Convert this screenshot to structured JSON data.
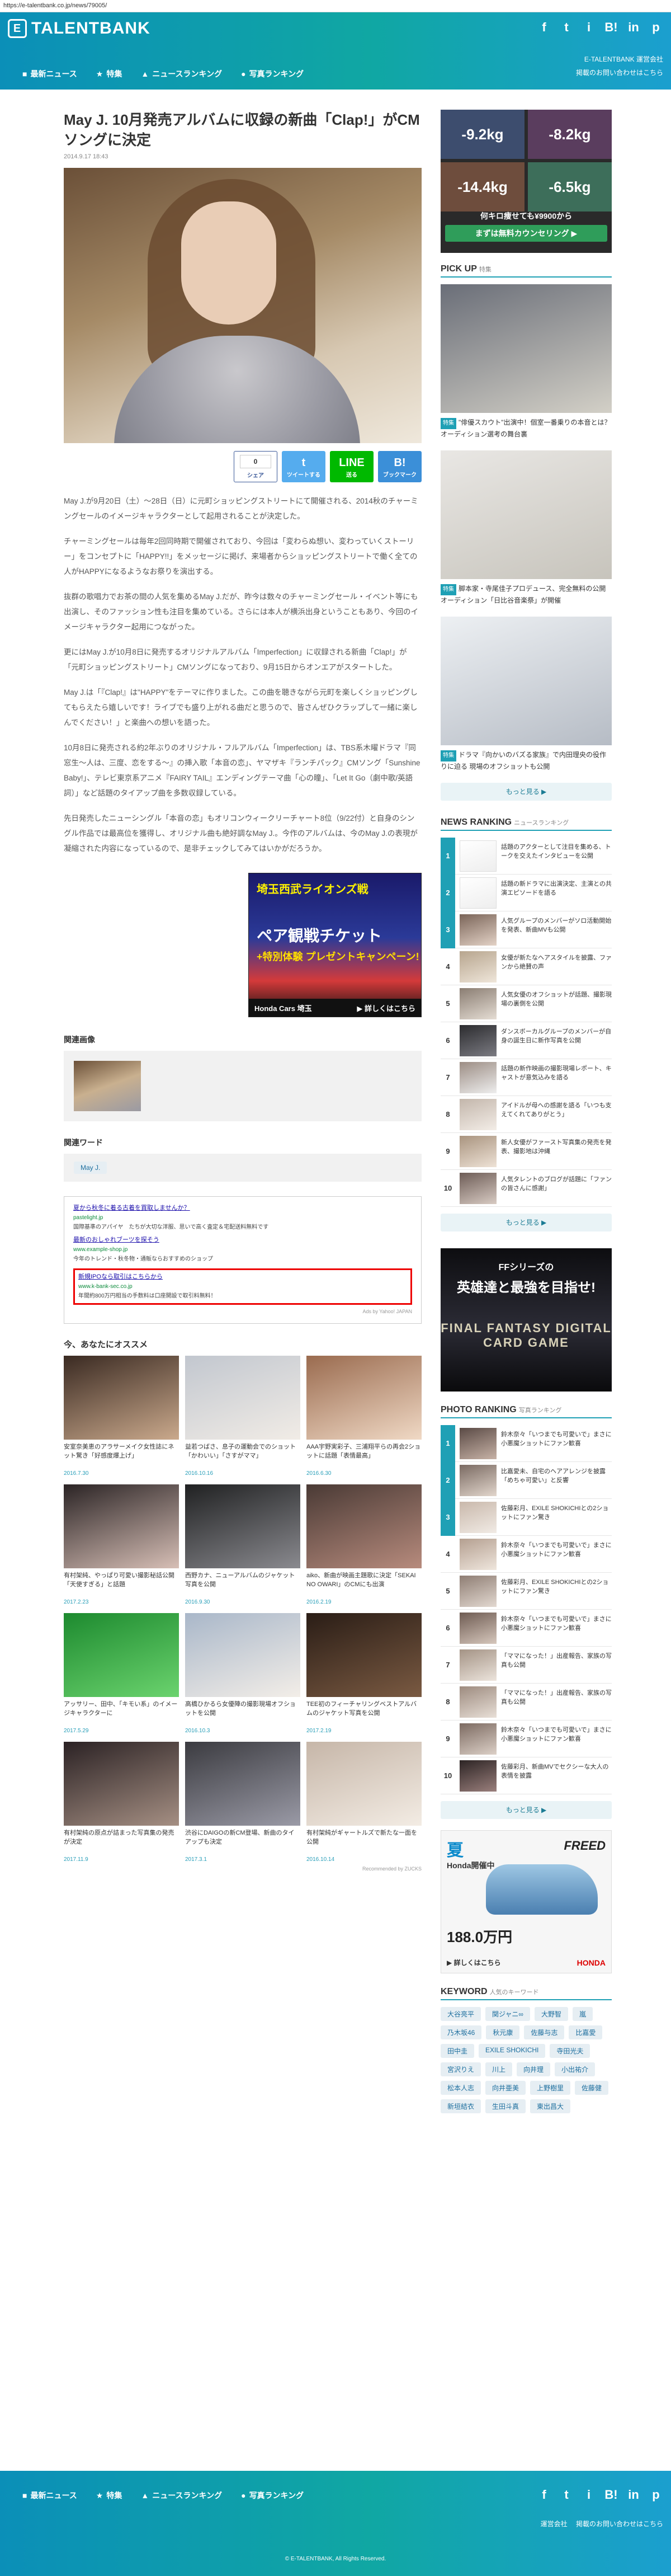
{
  "url": "https://e-talentbank.co.jp/news/79005/",
  "site": {
    "logo_text": "TALENTBANK",
    "social_icons": [
      "f",
      "t",
      "i",
      "B!",
      "in",
      "p"
    ],
    "header_links": [
      "E-TALENTBANK 運営会社",
      "掲載のお問い合わせはこちら"
    ],
    "nav": [
      {
        "icon": "news-icon",
        "glyph": "■",
        "label": "最新ニュース"
      },
      {
        "icon": "feature-icon",
        "glyph": "★",
        "label": "特集"
      },
      {
        "icon": "ranking-icon",
        "glyph": "▲",
        "label": "ニュースランキング"
      },
      {
        "icon": "photo-icon",
        "glyph": "●",
        "label": "写真ランキング"
      }
    ]
  },
  "article": {
    "title": "May J. 10月発売アルバムに収録の新曲「Clap!」がCMソングに決定",
    "date": "2014.9.17 18:43",
    "share": {
      "fb_count": "0",
      "fb_label": "シェア",
      "tw_glyph": "t",
      "tw_label": "ツイートする",
      "line_label": "送る",
      "hb_label": "ブックマーク"
    },
    "paragraphs": [
      "May J.が9月20日（土）〜28日（日）に元町ショッピングストリートにて開催される、2014秋のチャーミングセールのイメージキャラクターとして起用されることが決定した。",
      "チャーミングセールは毎年2回同時期で開催されており、今回は「変わらぬ想い、変わっていくストーリー」をコンセプトに「HAPPY!!」をメッセージに掲げ、来場者からショッピングストリートで働く全ての人がHAPPYになるようなお祭りを演出する。",
      "抜群の歌唱力でお茶の間の人気を集めるMay J.だが、昨今は数々のチャーミングセール・イベント等にも出演し、そのファッション性も注目を集めている。さらには本人が横浜出身ということもあり、今回のイメージキャラクター起用につながった。",
      "更にはMay J.が10月8日に発売するオリジナルアルバム「Imperfection」に収録される新曲「Clap!」が「元町ショッピングストリート」CMソングになっており、9月15日からオンエアがスタートした。",
      "May J.は「『Clap!』は\"HAPPY\"をテーマに作りました。この曲を聴きながら元町を楽しくショッピングしてもらえたら嬉しいです！ライブでも盛り上がれる曲だと思うので、皆さんぜひクラップして一緒に楽しんでください！」と楽曲への想いを語った。",
      "10月8日に発売される約2年ぶりのオリジナル・フルアルバム「Imperfection」は、TBS系木曜ドラマ『同窓生〜人は、三度、恋をする〜』の挿入歌「本音の恋」、ヤマザキ『ランチパック』CMソング「Sunshine Baby!」、テレビ東京系アニメ『FAIRY TAIL』エンディングテーマ曲「心の瞳」、「Let It Go（劇中歌/英語詞）」など話題のタイアップ曲を多数収録している。",
      "先日発売したニューシングル「本音の恋」もオリコンウィークリーチャート8位（9/22付）と自身のシングル作品では最高位を獲得し、オリジナル曲も絶好調なMay J.。今作のアルバムは、今のMay J.の表現が凝縮された内容になっているので、是非チェックしてみてはいかがだろうか。"
    ],
    "related_images_title": "関連画像",
    "related_words_title": "関連ワード",
    "related_words": [
      "May J."
    ]
  },
  "ad_honda": {
    "line1": "埼玉西武ライオンズ戦",
    "line2": "ペア観戦チケット",
    "line3": "+特別体験 プレゼントキャンペーン!",
    "brand": "Honda Cars 埼玉",
    "cta": "▶ 詳しくはこちら"
  },
  "yahoo_ads": {
    "items": [
      {
        "title": "夏から秋冬に着る古着を買取しませんか？",
        "url": "pastelight.jp",
        "desc": "国際基準のアパイヤ　たちが大切な洋服、思いで高く査定＆宅配送料無料です"
      },
      {
        "title": "最新のおしゃれブーツを探そう",
        "url": "www.example-shop.jp",
        "desc": "今年のトレンド・秋冬物・通販ならおすすめのショップ"
      }
    ],
    "highlight": {
      "title": "新規IPOなら取引はこちらから",
      "url": "www.k-bank-sec.co.jp",
      "desc": "年間約800万円相当の手数料は口座開設で取引料無料！"
    },
    "by": "Ads by Yahoo! JAPAN"
  },
  "recommend": {
    "title": "今、あなたにオススメ",
    "by": "Recommended by ZUCKS",
    "items": [
      {
        "caption": "安室奈美恵のアラサーメイク女性誌にネット驚き「好感度爆上げ」",
        "date": "2016.7.30",
        "c1": "#3a2a22",
        "c2": "#caa98c"
      },
      {
        "caption": "益若つばさ、息子の運動会でのショット「かわいい」「さすがママ」",
        "date": "2016.10.16",
        "c1": "#c2c7cf",
        "c2": "#f1ece6"
      },
      {
        "caption": "AAA宇野実彩子、三浦翔平らの再会2ショットに話題「表情最高」",
        "date": "2016.6.30",
        "c1": "#9a6b4f",
        "c2": "#f0d9c5"
      },
      {
        "caption": "有村架純、やっぱり可愛い撮影秘話公開「天使すぎる」と話題",
        "date": "2017.2.23",
        "c1": "#2b2425",
        "c2": "#d7bfb6"
      },
      {
        "caption": "西野カナ、ニューアルバムのジャケット写真を公開",
        "date": "2016.9.30",
        "c1": "#202122",
        "c2": "#8a8a8f"
      },
      {
        "caption": "aiko、新曲が映画主題歌に決定「SEKAI NO OWARI」のCMにも出演",
        "date": "2016.2.19",
        "c1": "#4a3a35",
        "c2": "#b78b7d"
      },
      {
        "caption": "アッサリー、田中、「キモい系」のイメージキャラクターに",
        "date": "2017.5.29",
        "c1": "#1d8a2f",
        "c2": "#6bd36e"
      },
      {
        "caption": "高橋ひかるら女優陣の撮影現場オフショットを公開",
        "date": "2016.10.3",
        "c1": "#a9b7c9",
        "c2": "#f3eee8"
      },
      {
        "caption": "TEE初のフィーチャリングベストアルバムのジャケット写真を公開",
        "date": "2017.2.19",
        "c1": "#2a1d16",
        "c2": "#7a5a42"
      },
      {
        "caption": "有村架純の原点が詰まった写真集の発売が決定",
        "date": "2017.11.9",
        "c1": "#2b2224",
        "c2": "#a58f83"
      },
      {
        "caption": "渋谷にDAIGOの新CM登場、新曲のタイアップも決定",
        "date": "2017.3.1",
        "c1": "#3b3b40",
        "c2": "#9a9aa6"
      },
      {
        "caption": "有村架純がギャートルズで新たな一面を公開",
        "date": "2016.10.14",
        "c1": "#c6b6a8",
        "c2": "#f3ece4"
      }
    ]
  },
  "ad_side": {
    "q1": "-9.2kg",
    "q2": "-8.2kg",
    "q3": "-14.4kg",
    "q4": "-6.5kg",
    "price": "何キロ痩せても¥9900から",
    "cta": "まずは無料カウンセリング ▶"
  },
  "pickup": {
    "title": "PICK UP",
    "sub": "特集",
    "items": [
      {
        "tag": "特集",
        "caption": "\"俳優スカウト\"出演中！個室一番乗りの本音とは？オーディション選考の舞台裏",
        "c1": "#6a6e78",
        "c2": "#d3d0c7"
      },
      {
        "tag": "特集",
        "caption": "脚本家・寺尾佳子プロデュース、完全無料の公開オーディション「日比谷音楽祭」が開催",
        "c1": "#e9e7e4",
        "c2": "#c7c4bc"
      },
      {
        "tag": "特集",
        "caption": "ドラマ『向かいのバズる家族』で内田理央の役作りに迫る 現場のオフショットも公開",
        "c1": "#edf0f3",
        "c2": "#b6bcc5"
      }
    ],
    "more": "もっと見る ▶"
  },
  "news_ranking": {
    "title": "NEWS RANKING",
    "sub": "ニュースランキング",
    "items": [
      {
        "no": "1",
        "text": "話題のアクターとして注目を集める、トークを交えたインタビューを公開",
        "c1": "#fff",
        "c2": "#eee"
      },
      {
        "no": "2",
        "text": "話題の新ドラマに出演決定、主演との共演エピソードを語る",
        "c1": "#fff",
        "c2": "#eee"
      },
      {
        "no": "3",
        "text": "人気グループのメンバーがソロ活動開始を発表、新曲MVも公開",
        "c1": "#7a6458",
        "c2": "#e3d2c6"
      },
      {
        "no": "4",
        "text": "女優が新たなヘアスタイルを披露、ファンから絶賛の声",
        "c1": "#b7a58e",
        "c2": "#efe6da"
      },
      {
        "no": "5",
        "text": "人気女優のオフショットが話題、撮影現場の裏側を公開",
        "c1": "#8a7d72",
        "c2": "#e5ddd4"
      },
      {
        "no": "6",
        "text": "ダンスボーカルグループのメンバーが自身の誕生日に新作写真を公開",
        "c1": "#2b2b2e",
        "c2": "#7b7b82"
      },
      {
        "no": "7",
        "text": "話題の新作映画の撮影現場レポート、キャストが意気込みを語る",
        "c1": "#9c8d84",
        "c2": "#eee"
      },
      {
        "no": "8",
        "text": "アイドルが母への感謝を語る「いつも支えてくれてありがとう」",
        "c1": "#c3b6ab",
        "c2": "#f3ede7"
      },
      {
        "no": "9",
        "text": "新人女優がファースト写真集の発売を発表、撮影地は沖縄",
        "c1": "#a9947f",
        "c2": "#eee2d6"
      },
      {
        "no": "10",
        "text": "人気タレントのブログが話題に「ファンの皆さんに感謝」",
        "c1": "#6d5c56",
        "c2": "#d8cbc3"
      }
    ],
    "more": "もっと見る ▶"
  },
  "ad_ff": {
    "line1": "FFシリーズの",
    "line2": "英雄達と最強を目指せ!",
    "line3": "FINAL FANTASY DIGITAL CARD GAME"
  },
  "photo_ranking": {
    "title": "PHOTO RANKING",
    "sub": "写真ランキング",
    "items": [
      {
        "no": "1",
        "text": "鈴木奈々「いつまでも可愛いで」まさに小悪魔ショットにファン歓喜",
        "c1": "#5a4a45",
        "c2": "#c7b2a6"
      },
      {
        "no": "2",
        "text": "比嘉愛未、自宅のヘアアレンジを披露「めちゃ可愛い」と反響",
        "c1": "#7a6a62",
        "c2": "#e2d6cc"
      },
      {
        "no": "3",
        "text": "佐藤彩月、EXILE SHOKICHIとの2ショットにファン驚き",
        "c1": "#c9b8ab",
        "c2": "#f1ebe5"
      },
      {
        "no": "4",
        "text": "鈴木奈々「いつまでも可愛いで」まさに小悪魔ショットにファン歓喜",
        "c1": "#b49f90",
        "c2": "#efe6dd"
      },
      {
        "no": "5",
        "text": "佐藤彩月、EXILE SHOKICHIとの2ショットにファン驚き",
        "c1": "#8e7d73",
        "c2": "#e3d9d1"
      },
      {
        "no": "6",
        "text": "鈴木奈々「いつまでも可愛いで」まさに小悪魔ショットにファン歓喜",
        "c1": "#6e5b52",
        "c2": "#d6c7bc"
      },
      {
        "no": "7",
        "text": "「ママになった！」出産報告、家族の写真も公開",
        "c1": "#a49385",
        "c2": "#ece4dc"
      },
      {
        "no": "8",
        "text": "「ママになった！」出産報告、家族の写真も公開",
        "c1": "#9d8b7f",
        "c2": "#e8dfd7"
      },
      {
        "no": "9",
        "text": "鈴木奈々「いつまでも可愛いで」まさに小悪魔ショットにファン歓喜",
        "c1": "#7c6a61",
        "c2": "#dcd0c7"
      },
      {
        "no": "10",
        "text": "佐藤彩月、新曲MVでセクシーな大人の表情を披露",
        "c1": "#2c2424",
        "c2": "#9a7f7c"
      }
    ],
    "more": "もっと見る ▶"
  },
  "ad_car": {
    "n1": "夏",
    "n2": "Honda開催中",
    "brand": "FREED",
    "price": "188.0万円",
    "cta": "▶ 詳しくはこちら",
    "honda": "HONDA"
  },
  "keywords": {
    "title": "KEYWORD",
    "sub": "人気のキーワード",
    "items": [
      "大谷亮平",
      "関ジャニ∞",
      "大野智",
      "嵐",
      "乃木坂46",
      "秋元康",
      "佐藤与志",
      "比嘉愛",
      "田中圭",
      "EXILE SHOKICHI",
      "寺田光夫",
      "宮沢りえ",
      "川上",
      "向井理",
      "小出祐介",
      "松本人志",
      "向井亜美",
      "上野樹里",
      "佐藤健",
      "新垣結衣",
      "生田斗真",
      "東出昌大"
    ]
  },
  "footer": {
    "links": [
      "運営会社",
      "掲載のお問い合わせはこちら"
    ],
    "copyright": "© E-TALENTBANK, All Rights Reserved."
  }
}
